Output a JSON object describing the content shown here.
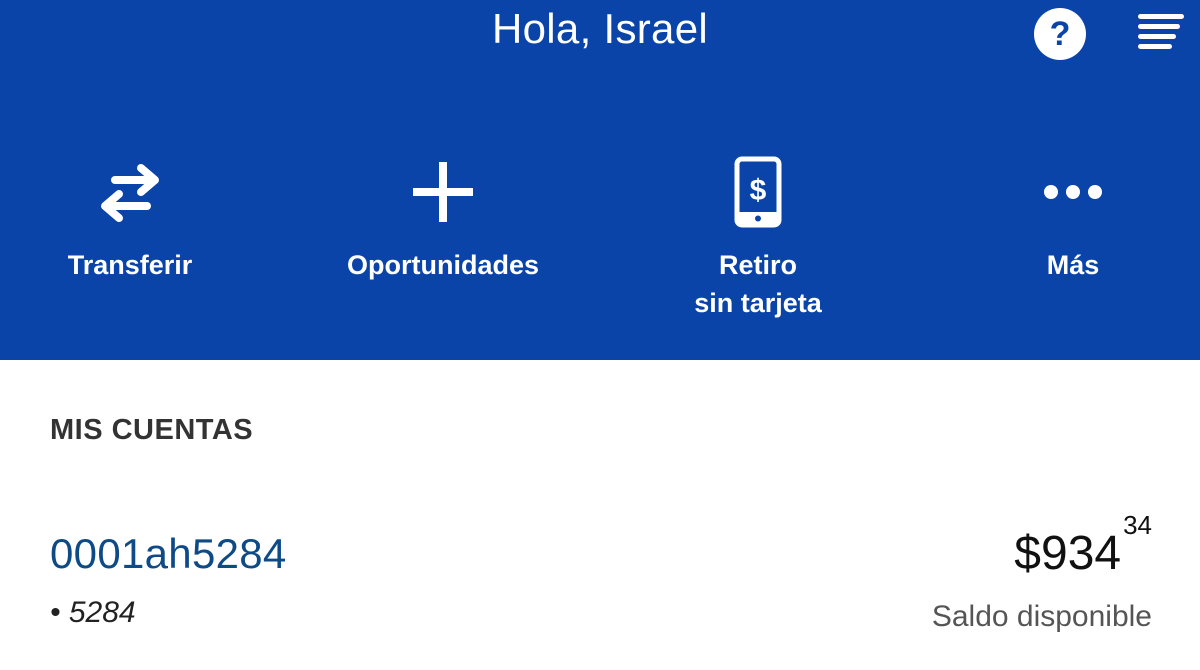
{
  "header": {
    "greeting": "Hola, Israel",
    "help_icon": "question-circle-icon",
    "menu_icon": "hamburger-menu-icon",
    "accent_color": "#0a44a8"
  },
  "actions": [
    {
      "label": "Transferir",
      "icon": "transfer-arrows-icon"
    },
    {
      "label": "Oportunidades",
      "icon": "plus-icon"
    },
    {
      "label_line1": "Retiro",
      "label_line2": "sin tarjeta",
      "icon": "phone-dollar-icon"
    },
    {
      "label": "Más",
      "icon": "more-dots-icon"
    }
  ],
  "accounts": {
    "title": "MIS CUENTAS",
    "items": [
      {
        "name": "0001ah5284",
        "masked_number": "• 5284",
        "balance_main": "$934",
        "balance_cents": "34",
        "balance_label": "Saldo disponible"
      }
    ]
  }
}
